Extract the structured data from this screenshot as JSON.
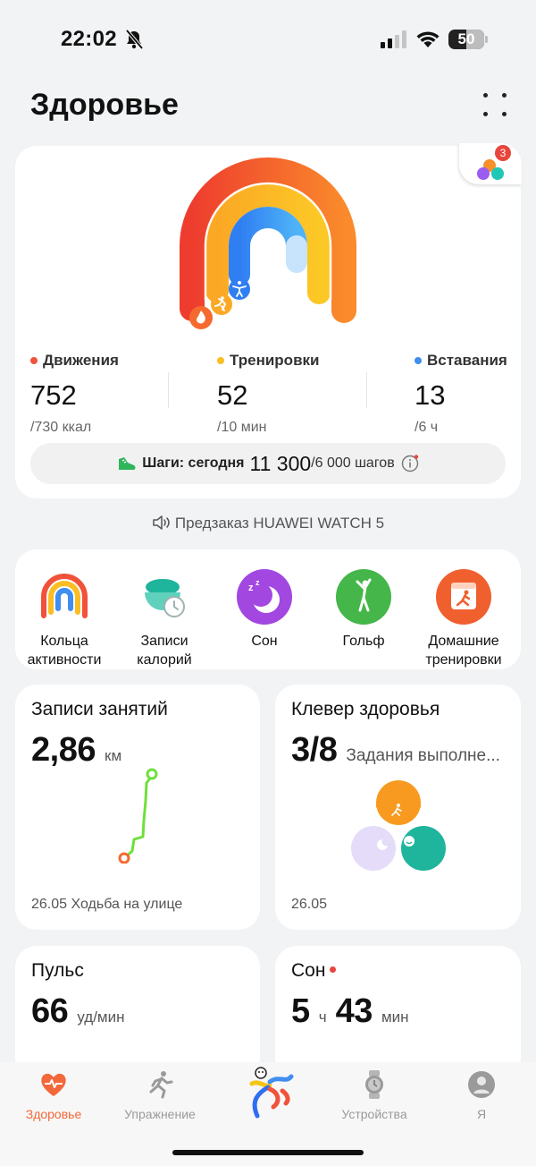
{
  "status": {
    "time": "22:02",
    "battery": "50"
  },
  "header": {
    "title": "Здоровье"
  },
  "rings": {
    "badge_count": "3",
    "metrics": [
      {
        "label": "Движения",
        "value": "752",
        "goal": "/730 ккал",
        "color": "#f0523a"
      },
      {
        "label": "Тренировки",
        "value": "52",
        "goal": "/10 мин",
        "color": "#fbbd24"
      },
      {
        "label": "Вставания",
        "value": "13",
        "goal": "/6 ч",
        "color": "#3f8ef0"
      }
    ],
    "steps": {
      "label": "Шаги: сегодня",
      "value": "11 300",
      "goal": "/6 000 шагов"
    }
  },
  "promo": {
    "text": "Предзаказ HUAWEI WATCH 5"
  },
  "shortcuts": [
    {
      "line1": "Кольца",
      "line2": "активности"
    },
    {
      "line1": "Записи",
      "line2": "калорий"
    },
    {
      "line1": "Сон",
      "line2": ""
    },
    {
      "line1": "Гольф",
      "line2": ""
    },
    {
      "line1": "Домашние",
      "line2": "тренировки"
    }
  ],
  "tiles": {
    "activity": {
      "title": "Записи занятий",
      "value": "2,86",
      "unit": "км",
      "footer": "26.05 Ходьба на улице"
    },
    "clover": {
      "title": "Клевер здоровья",
      "value": "3/8",
      "subtitle": "Задания выполне...",
      "footer": "26.05"
    },
    "pulse": {
      "title": "Пульс",
      "value": "66",
      "unit": "уд/мин"
    },
    "sleep": {
      "title": "Сон",
      "hours": "5",
      "hours_unit": "ч",
      "minutes": "43",
      "minutes_unit": "мин"
    }
  },
  "tabbar": {
    "items": [
      {
        "label": "Здоровье"
      },
      {
        "label": "Упражнение"
      },
      {
        "label": "Устройства"
      },
      {
        "label": "Я"
      }
    ]
  },
  "colors": {
    "accent": "#f2683a",
    "move": "#f0523a",
    "exercise": "#fbbd24",
    "stand": "#3f8ef0"
  }
}
